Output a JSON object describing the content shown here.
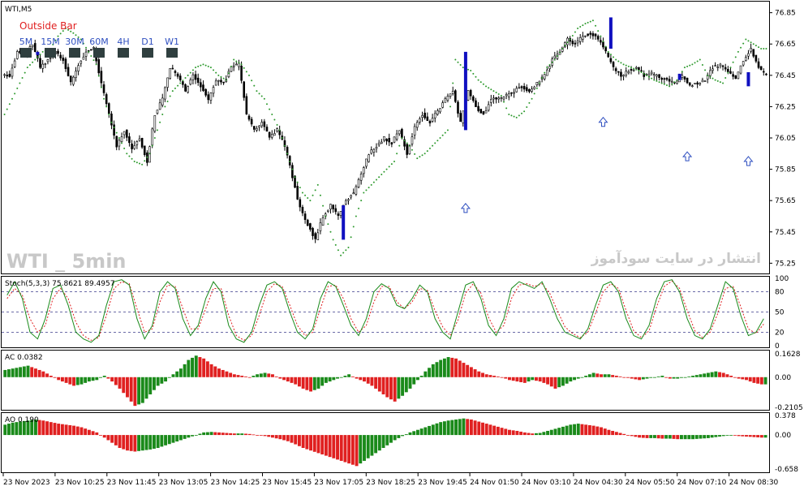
{
  "chart_data": [
    {
      "pane": "price",
      "type": "candlestick",
      "title": "WTI,M5",
      "indicator_label": "Outside Bar",
      "timeframes": [
        "5M",
        "15M",
        "30M",
        "60M",
        "4H",
        "D1",
        "W1"
      ],
      "watermark": "WTI _ 5min",
      "watermark_fa": "انتشار در سایت سودآموز",
      "ylim": [
        75.2,
        76.9
      ],
      "yticks": [
        76.85,
        76.65,
        76.45,
        76.25,
        76.05,
        75.85,
        75.65,
        75.45,
        75.25
      ],
      "close_path": [
        76.45,
        76.6,
        76.58,
        76.65,
        76.5,
        76.55,
        76.6,
        76.55,
        76.4,
        76.52,
        76.6,
        76.62,
        76.4,
        76.2,
        76.0,
        76.1,
        75.98,
        76.05,
        75.9,
        76.2,
        76.3,
        76.5,
        76.45,
        76.35,
        76.45,
        76.38,
        76.3,
        76.42,
        76.4,
        76.5,
        76.52,
        76.2,
        76.1,
        76.15,
        76.05,
        76.1,
        76.0,
        75.8,
        75.6,
        75.5,
        75.4,
        75.55,
        75.62,
        75.55,
        75.65,
        75.7,
        75.82,
        75.95,
        76.0,
        76.05,
        76.02,
        76.1,
        75.95,
        76.12,
        76.2,
        76.15,
        76.22,
        76.3,
        76.35,
        76.15,
        76.35,
        76.25,
        76.2,
        76.3,
        76.3,
        76.32,
        76.35,
        76.38,
        76.35,
        76.4,
        76.45,
        76.55,
        76.6,
        76.68,
        76.65,
        76.7,
        76.72,
        76.68,
        76.6,
        76.5,
        76.45,
        76.48,
        76.5,
        76.45,
        76.46,
        76.44,
        76.42,
        76.4,
        76.45,
        76.38,
        76.4,
        76.42,
        76.5,
        76.52,
        76.48,
        76.42,
        76.55,
        76.62,
        76.5,
        76.45
      ],
      "psar_path": [
        76.2,
        76.3,
        76.4,
        76.5,
        76.55,
        76.6,
        76.62,
        76.7,
        76.75,
        76.72,
        76.68,
        76.6,
        76.52,
        76.3,
        76.15,
        76.05,
        75.95,
        75.9,
        75.88,
        75.95,
        76.1,
        76.25,
        76.35,
        76.4,
        76.45,
        76.5,
        76.52,
        76.5,
        76.45,
        76.42,
        76.55,
        76.52,
        76.45,
        76.35,
        76.3,
        76.2,
        76.1,
        75.95,
        75.8,
        75.7,
        75.65,
        75.75,
        75.55,
        75.4,
        75.3,
        75.35,
        75.55,
        75.7,
        75.75,
        75.8,
        75.85,
        75.9,
        76.05,
        76.0,
        75.92,
        75.95,
        76.0,
        76.05,
        76.1,
        76.55,
        76.5,
        76.48,
        76.42,
        76.38,
        76.35,
        76.32,
        76.2,
        76.18,
        76.22,
        76.3,
        76.4,
        76.5,
        76.55,
        76.62,
        76.68,
        76.75,
        76.78,
        76.8,
        76.7,
        76.6,
        76.55,
        76.52,
        76.5,
        76.48,
        76.45,
        76.42,
        76.4,
        76.38,
        76.42,
        76.5,
        76.52,
        76.55,
        76.45,
        76.42,
        76.4,
        76.5,
        76.6,
        76.68,
        76.65,
        76.62
      ],
      "outside_bars": [
        {
          "bar": 4,
          "high": 76.6,
          "low": 76.58
        },
        {
          "bar": 44,
          "high": 75.62,
          "low": 75.4
        },
        {
          "bar": 60,
          "high": 76.6,
          "low": 76.1
        },
        {
          "bar": 79,
          "high": 76.82,
          "low": 76.62
        },
        {
          "bar": 88,
          "high": 76.46,
          "low": 76.42
        },
        {
          "bar": 97,
          "high": 76.47,
          "low": 76.38
        }
      ],
      "up_arrows": [
        {
          "bar": 60,
          "price": 75.6
        },
        {
          "bar": 78,
          "price": 76.15
        },
        {
          "bar": 89,
          "price": 75.93
        },
        {
          "bar": 97,
          "price": 75.9
        }
      ]
    },
    {
      "pane": "stochastic",
      "type": "line",
      "title": "Stoch(5,3,3) 75.8621 89.4957",
      "ylim": [
        0,
        100
      ],
      "yticks": [
        100,
        80,
        50,
        20,
        0
      ],
      "levels": [
        80,
        50,
        20
      ],
      "main_values": [
        75,
        95,
        70,
        20,
        10,
        40,
        85,
        90,
        60,
        20,
        10,
        5,
        15,
        60,
        95,
        98,
        90,
        40,
        10,
        30,
        80,
        95,
        85,
        40,
        15,
        30,
        70,
        95,
        80,
        30,
        10,
        5,
        20,
        60,
        90,
        95,
        85,
        50,
        20,
        10,
        25,
        70,
        95,
        88,
        60,
        30,
        15,
        40,
        80,
        92,
        85,
        60,
        55,
        70,
        90,
        80,
        40,
        20,
        10,
        50,
        90,
        95,
        70,
        30,
        15,
        40,
        85,
        95,
        90,
        85,
        95,
        70,
        40,
        20,
        15,
        10,
        25,
        60,
        90,
        95,
        80,
        40,
        15,
        10,
        30,
        70,
        95,
        98,
        80,
        40,
        15,
        10,
        25,
        60,
        95,
        85,
        45,
        15,
        20,
        40
      ],
      "signal_values": [
        70,
        85,
        75,
        40,
        20,
        30,
        70,
        85,
        70,
        35,
        15,
        8,
        12,
        45,
        85,
        95,
        92,
        55,
        20,
        25,
        65,
        90,
        88,
        55,
        25,
        25,
        55,
        85,
        85,
        45,
        15,
        8,
        15,
        45,
        80,
        92,
        88,
        60,
        30,
        15,
        20,
        55,
        88,
        90,
        70,
        40,
        20,
        30,
        65,
        88,
        88,
        65,
        55,
        65,
        85,
        82,
        52,
        28,
        15,
        38,
        78,
        92,
        78,
        42,
        20,
        30,
        70,
        90,
        92,
        88,
        92,
        78,
        52,
        28,
        18,
        12,
        20,
        48,
        80,
        92,
        85,
        52,
        22,
        12,
        22,
        58,
        88,
        96,
        85,
        52,
        22,
        12,
        20,
        48,
        85,
        88,
        58,
        25,
        18,
        32
      ]
    },
    {
      "pane": "accelerator",
      "type": "bar",
      "title": "AC 0.0382",
      "ylim": [
        -0.2105,
        0.1628
      ],
      "yticks": [
        0.1628,
        0.0,
        -0.2105
      ],
      "values": [
        0.05,
        0.06,
        0.07,
        0.08,
        0.06,
        0.04,
        0.01,
        -0.02,
        -0.04,
        -0.06,
        -0.05,
        -0.03,
        -0.02,
        0.01,
        -0.03,
        -0.08,
        -0.14,
        -0.2,
        -0.18,
        -0.12,
        -0.06,
        -0.03,
        0.02,
        0.06,
        0.12,
        0.15,
        0.13,
        0.09,
        0.06,
        0.04,
        0.02,
        0.01,
        0.0,
        0.02,
        0.03,
        0.02,
        -0.01,
        -0.03,
        -0.05,
        -0.08,
        -0.1,
        -0.08,
        -0.04,
        -0.02,
        0.0,
        0.02,
        -0.01,
        -0.03,
        -0.06,
        -0.1,
        -0.14,
        -0.17,
        -0.13,
        -0.08,
        -0.02,
        0.04,
        0.09,
        0.12,
        0.14,
        0.13,
        0.1,
        0.07,
        0.04,
        0.02,
        0.01,
        0.0,
        -0.02,
        -0.03,
        -0.04,
        -0.02,
        -0.03,
        -0.05,
        -0.08,
        -0.06,
        -0.03,
        -0.01,
        0.01,
        0.03,
        0.02,
        0.02,
        0.01,
        0.0,
        -0.01,
        -0.02,
        -0.01,
        0.0,
        0.01,
        -0.01,
        -0.01,
        0.0,
        0.01,
        0.02,
        0.03,
        0.04,
        0.03,
        0.01,
        -0.01,
        -0.02,
        -0.04,
        -0.05
      ]
    },
    {
      "pane": "awesome",
      "type": "bar",
      "title": "AO 0.190",
      "ylim": [
        -0.658,
        0.378
      ],
      "yticks": [
        0.378,
        0.0,
        -0.658
      ],
      "values": [
        0.2,
        0.24,
        0.26,
        0.28,
        0.3,
        0.28,
        0.25,
        0.22,
        0.2,
        0.18,
        0.15,
        0.1,
        0.05,
        -0.05,
        -0.15,
        -0.25,
        -0.3,
        -0.32,
        -0.3,
        -0.28,
        -0.25,
        -0.2,
        -0.15,
        -0.1,
        -0.05,
        0.0,
        0.05,
        0.06,
        0.05,
        0.04,
        0.03,
        0.03,
        0.02,
        0.0,
        -0.02,
        -0.05,
        -0.08,
        -0.12,
        -0.18,
        -0.25,
        -0.3,
        -0.35,
        -0.4,
        -0.45,
        -0.5,
        -0.55,
        -0.6,
        -0.5,
        -0.4,
        -0.3,
        -0.2,
        -0.1,
        -0.02,
        0.05,
        0.1,
        0.15,
        0.2,
        0.25,
        0.28,
        0.3,
        0.32,
        0.3,
        0.26,
        0.22,
        0.18,
        0.14,
        0.1,
        0.08,
        0.05,
        0.03,
        0.04,
        0.08,
        0.12,
        0.16,
        0.2,
        0.22,
        0.2,
        0.18,
        0.15,
        0.1,
        0.06,
        0.02,
        -0.02,
        -0.05,
        -0.06,
        -0.06,
        -0.07,
        -0.07,
        -0.08,
        -0.08,
        -0.08,
        -0.07,
        -0.06,
        -0.04,
        -0.02,
        0.0,
        -0.02,
        -0.03,
        -0.04,
        -0.05
      ]
    }
  ],
  "time_axis": [
    "23 Nov 2023",
    "23 Nov 10:25",
    "23 Nov 11:45",
    "23 Nov 13:05",
    "23 Nov 14:25",
    "23 Nov 15:45",
    "23 Nov 17:05",
    "23 Nov 18:25",
    "23 Nov 19:45",
    "24 Nov 01:50",
    "24 Nov 03:10",
    "24 Nov 04:30",
    "24 Nov 05:50",
    "24 Nov 07:10",
    "24 Nov 08:30"
  ],
  "colors": {
    "background": "#ffffff",
    "candle": "#000000",
    "psar": "#2e9a2e",
    "outside_bar": "#1010c0",
    "arrow": "#2f4fc0",
    "stoch_main": "#1a8a1a",
    "stoch_signal": "#e02020",
    "level_line": "#3a3a8a",
    "histogram_up": "#1a8a1a",
    "histogram_down": "#e02020",
    "label_red": "#e02020",
    "label_blue": "#3050c0",
    "tf_box": "#2f3f3f",
    "watermark": "#c0c0c0"
  }
}
